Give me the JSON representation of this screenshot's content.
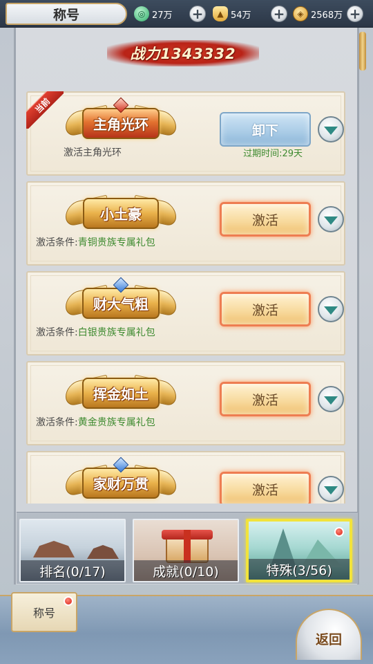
{
  "header": {
    "title": "称号",
    "resources": [
      {
        "icon": "jade-icon",
        "value": "27万",
        "color": "#2fae6a"
      },
      {
        "icon": "gold-ingot-icon",
        "value": "54万",
        "color": "#e2a93a"
      },
      {
        "icon": "copper-coin-icon",
        "value": "2568万",
        "color": "#d89a2a"
      }
    ]
  },
  "combat_power": "战力1343332",
  "titles": [
    {
      "name": "主角光环",
      "badge": "当前",
      "condition": "激活主角光环",
      "expire": "过期时间:29天",
      "button": "卸下"
    },
    {
      "name": "小土豪",
      "condition_prefix": "激活条件:",
      "condition_value": "青铜贵族专属礼包",
      "button": "激活"
    },
    {
      "name": "财大气粗",
      "condition_prefix": "激活条件:",
      "condition_value": "白银贵族专属礼包",
      "button": "激活"
    },
    {
      "name": "挥金如土",
      "condition_prefix": "激活条件:",
      "condition_value": "黄金贵族专属礼包",
      "button": "激活"
    },
    {
      "name": "家财万贯",
      "button": "激活"
    }
  ],
  "tabs": [
    {
      "label": "排名(0/17)"
    },
    {
      "label": "成就(0/10)"
    },
    {
      "label": "特殊(3/56)"
    }
  ],
  "bottom": {
    "selected_tab": "称号",
    "back": "返回"
  }
}
